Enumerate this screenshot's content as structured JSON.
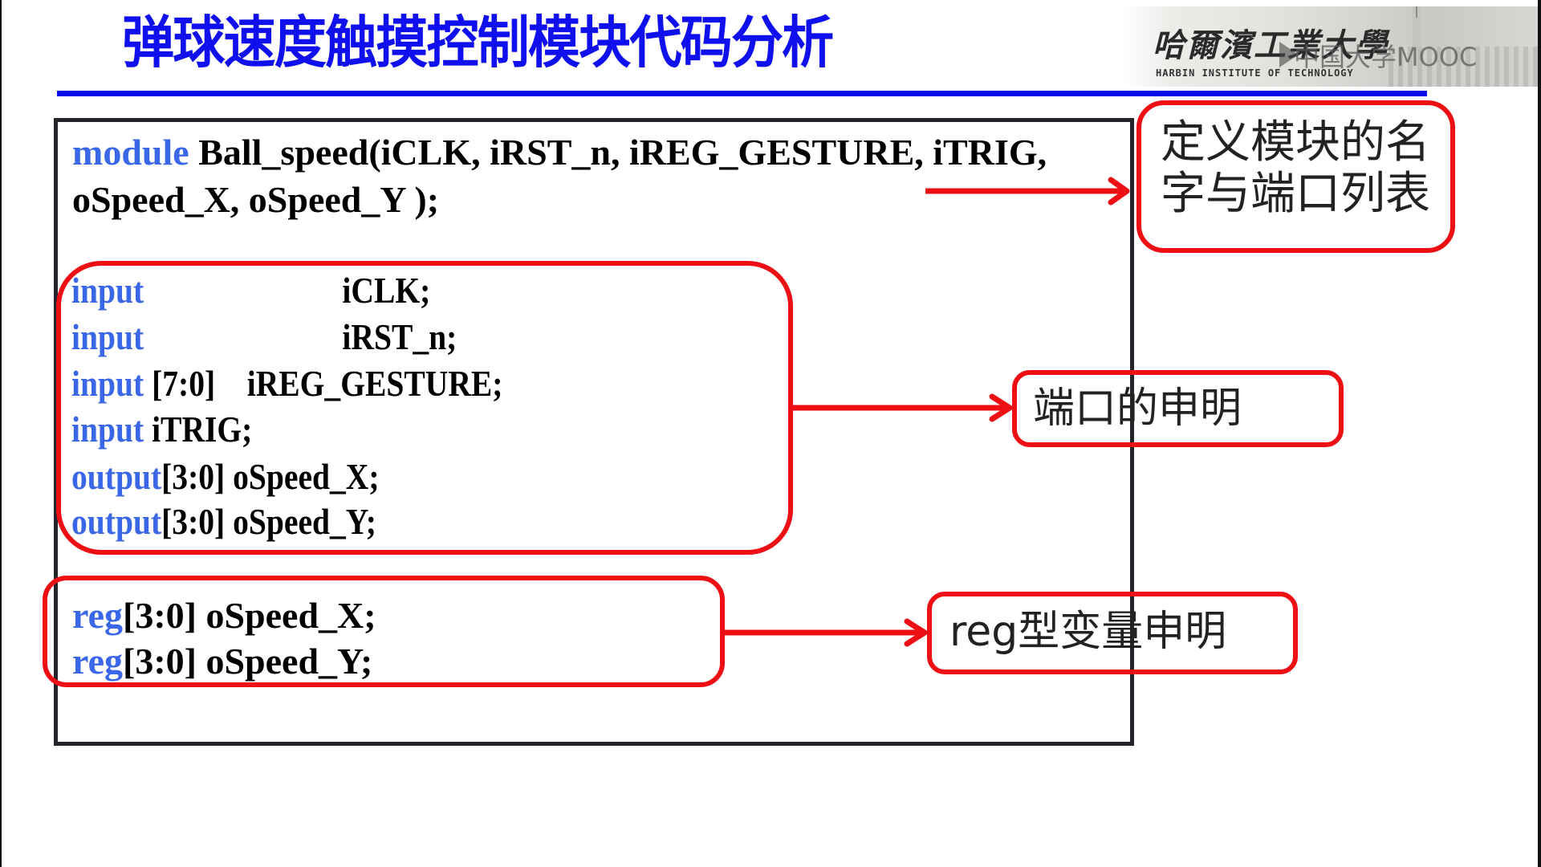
{
  "slide": {
    "title": "弹球速度触摸控制模块代码分析",
    "logo": {
      "university_cn": "哈爾濱工業大學",
      "university_en": "HARBIN INSTITUTE OF TECHNOLOGY",
      "watermark": "中国大学MOOC"
    },
    "colors": {
      "title": "#1010ee",
      "keyword": "#3a66e8",
      "annotation": "#ee0f14"
    }
  },
  "code": {
    "module_decl": {
      "keyword": "module",
      "line1_rest": " Ball_speed(iCLK, iRST_n, iREG_GESTURE, iTRIG,",
      "line2": "oSpeed_X, oSpeed_Y );"
    },
    "ports": [
      {
        "keyword": "input",
        "rest": "                         iCLK;"
      },
      {
        "keyword": "input",
        "rest": "                         iRST_n;"
      },
      {
        "keyword": "input",
        "rest": " [7:0]    iREG_GESTURE;"
      },
      {
        "keyword": "input",
        "rest": " iTRIG;"
      },
      {
        "keyword": "output",
        "rest": "[3:0] oSpeed_X;"
      },
      {
        "keyword": "output",
        "rest": "[3:0] oSpeed_Y;"
      }
    ],
    "regs": [
      {
        "keyword": "reg",
        "rest": "[3:0] oSpeed_X;"
      },
      {
        "keyword": "reg",
        "rest": "[3:0] oSpeed_Y;"
      }
    ]
  },
  "annotations": {
    "module_label_line1": "定义模块的名",
    "module_label_line2": "字与端口列表",
    "port_label": "端口的申明",
    "reg_label": "reg型变量申明"
  }
}
